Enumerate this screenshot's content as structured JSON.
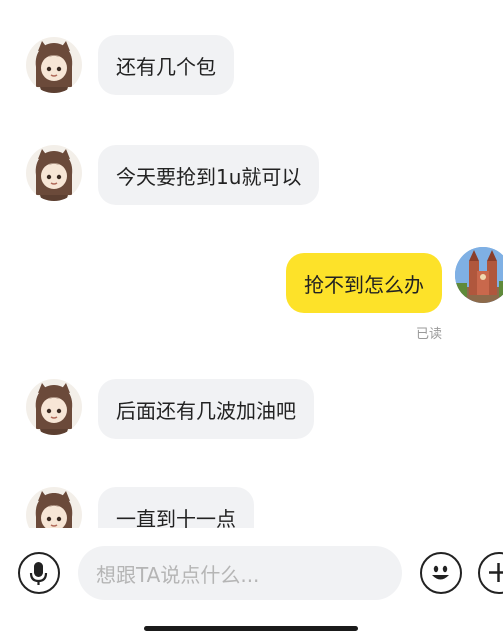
{
  "messages": [
    {
      "side": "in",
      "text": "还有几个包"
    },
    {
      "side": "in",
      "text": "今天要抢到1u就可以"
    },
    {
      "side": "out",
      "text": "抢不到怎么办",
      "status": "已读"
    },
    {
      "side": "in",
      "text": "后面还有几波加油吧"
    },
    {
      "side": "in",
      "text": "一直到十一点"
    }
  ],
  "input": {
    "placeholder": "想跟TA说点什么..."
  },
  "colors": {
    "incoming_bubble": "#f1f2f4",
    "outgoing_bubble": "#fde229",
    "input_bg": "#f1f2f4"
  },
  "icons": {
    "mic": "microphone-icon",
    "emoji": "smiley-icon",
    "plus": "plus-icon"
  }
}
